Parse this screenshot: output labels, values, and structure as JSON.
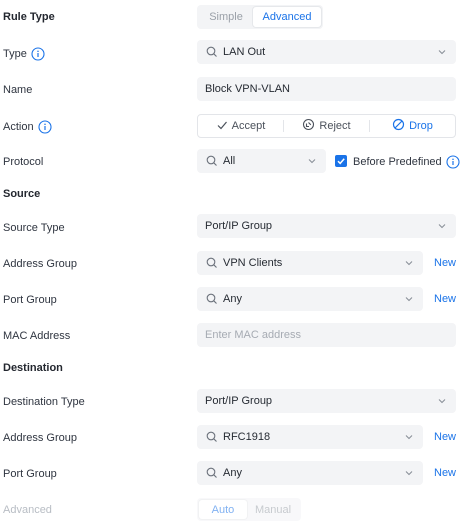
{
  "rule_type": {
    "label": "Rule Type",
    "options": [
      "Simple",
      "Advanced"
    ],
    "selected": "Advanced"
  },
  "type": {
    "label": "Type",
    "value": "LAN Out"
  },
  "name": {
    "label": "Name",
    "value": "Block VPN-VLAN"
  },
  "action": {
    "label": "Action",
    "options": [
      "Accept",
      "Reject",
      "Drop"
    ],
    "selected": "Drop"
  },
  "protocol": {
    "label": "Protocol",
    "value": "All",
    "before_predefined_label": "Before Predefined",
    "before_predefined_checked": true
  },
  "source": {
    "heading": "Source",
    "type_label": "Source Type",
    "type_value": "Port/IP Group",
    "address_group_label": "Address Group",
    "address_group_value": "VPN Clients",
    "address_new": "New",
    "port_group_label": "Port Group",
    "port_group_value": "Any",
    "port_new": "New",
    "mac_label": "MAC Address",
    "mac_placeholder": "Enter MAC address"
  },
  "destination": {
    "heading": "Destination",
    "type_label": "Destination Type",
    "type_value": "Port/IP Group",
    "address_group_label": "Address Group",
    "address_group_value": "RFC1918",
    "address_new": "New",
    "port_group_label": "Port Group",
    "port_group_value": "Any",
    "port_new": "New"
  },
  "advanced": {
    "label": "Advanced",
    "options": [
      "Auto",
      "Manual"
    ],
    "selected": "Auto"
  },
  "colors": {
    "accent": "#1a73e8",
    "field_bg": "#f3f4f6",
    "text": "#2f3540"
  }
}
